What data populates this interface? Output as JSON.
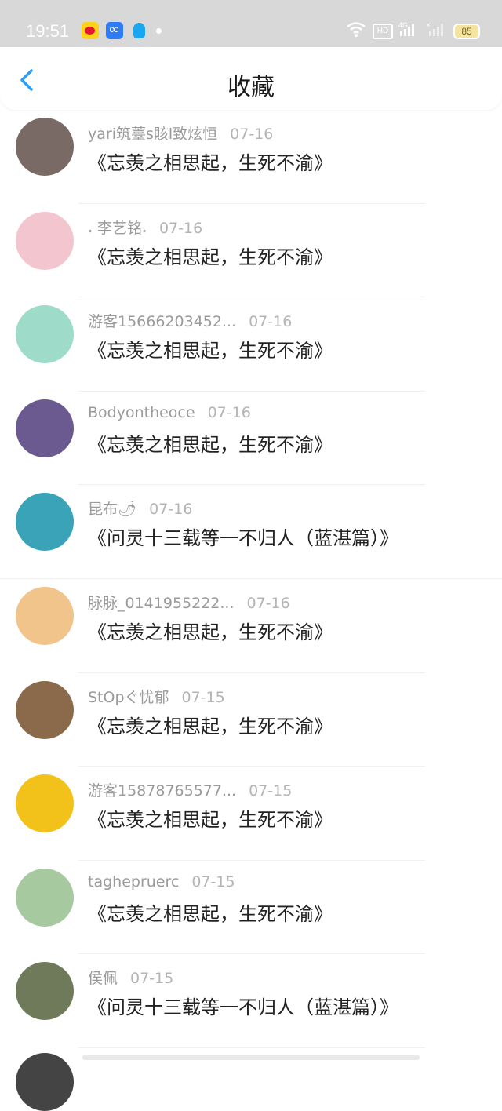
{
  "status_bar": {
    "time": "19:51",
    "battery": "85",
    "network": "4G",
    "hd_label": "HD"
  },
  "header": {
    "title": "收藏",
    "back_icon": "chevron-left-icon"
  },
  "favorites": [
    {
      "user": "yari筑薹s賅l致炫恒",
      "date": "07-16",
      "title": "《忘羡之相思起，生死不渝》",
      "avatar_color": "#7a6a66"
    },
    {
      "user": "𝆺 李艺铭𝆺",
      "date": "07-16",
      "title": "《忘羡之相思起，生死不渝》",
      "avatar_color": "#f3c6cf"
    },
    {
      "user": "游客15666203452...",
      "date": "07-16",
      "title": "《忘羡之相思起，生死不渝》",
      "avatar_color": "#9edbc9"
    },
    {
      "user": "Bodyontheoce",
      "date": "07-16",
      "title": "《忘羡之相思起，生死不渝》",
      "avatar_color": "#6b5a8f"
    },
    {
      "user": "昆布🌶",
      "date": "07-16",
      "title": "《问灵十三载等一不归人（蓝湛篇）》",
      "avatar_color": "#3ba3b7"
    },
    {
      "user": "脉脉_0141955222...",
      "date": "07-16",
      "title": "《忘羡之相思起，生死不渝》",
      "avatar_color": "#f0c48a"
    },
    {
      "user": "StOpぐ忧郁",
      "date": "07-15",
      "title": "《忘羡之相思起，生死不渝》",
      "avatar_color": "#8a6a4a"
    },
    {
      "user": "游客15878765577...",
      "date": "07-15",
      "title": "《忘羡之相思起，生死不渝》",
      "avatar_color": "#f2c21a"
    },
    {
      "user": "taghepruerc",
      "date": "07-15",
      "title": "《忘羡之相思起，生死不渝》",
      "avatar_color": "#a7c9a0"
    },
    {
      "user": "侯佩",
      "date": "07-15",
      "title": "《问灵十三载等一不归人（蓝湛篇）》",
      "avatar_color": "#6f7a5a"
    }
  ]
}
